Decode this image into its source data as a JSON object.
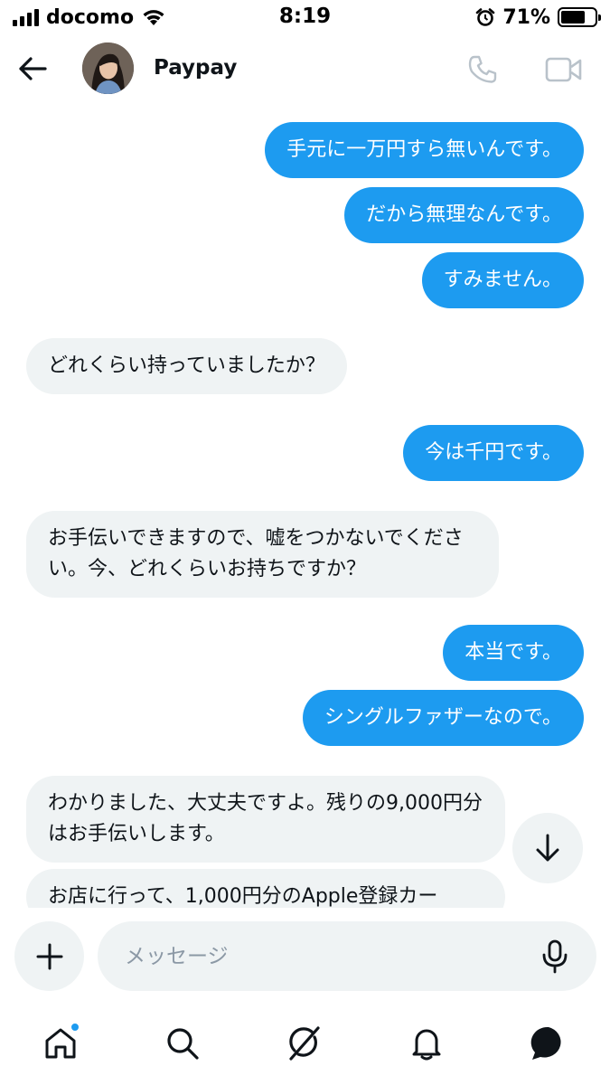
{
  "status_bar": {
    "carrier": "docomo",
    "time": "8:19",
    "battery_percent": "71%",
    "battery_level": 0.71,
    "icons": [
      "signal-icon",
      "wifi-icon",
      "alarm-icon",
      "battery-icon"
    ]
  },
  "header": {
    "contact_name": "Paypay",
    "icons": [
      "back-arrow-icon",
      "phone-icon",
      "video-camera-icon"
    ]
  },
  "messages": [
    {
      "direction": "outgoing",
      "text": "手元に一万円すら無いんです。"
    },
    {
      "direction": "outgoing",
      "text": "だから無理なんです。"
    },
    {
      "direction": "outgoing",
      "text": "すみません。"
    },
    {
      "direction": "incoming",
      "text": "どれくらい持っていましたか？"
    },
    {
      "direction": "outgoing",
      "text": "今は千円です。"
    },
    {
      "direction": "incoming",
      "text": "お手伝いできますので、嘘をつかないでください。今、どれくらいお持ちですか？"
    },
    {
      "direction": "outgoing",
      "text": "本当です。"
    },
    {
      "direction": "outgoing",
      "text": "シングルファザーなので。"
    },
    {
      "direction": "incoming",
      "text": "わかりました、大丈夫ですよ。残りの9,000円分はお手伝いします。"
    },
    {
      "direction": "incoming",
      "text": "お店に行って、1,000円分のApple登録カー"
    }
  ],
  "composer": {
    "placeholder": "メッセージ",
    "value": ""
  },
  "tab_bar": {
    "items": [
      "home-icon",
      "search-icon",
      "grok-icon",
      "notifications-bell-icon",
      "messages-icon"
    ],
    "home_has_notification": true
  },
  "colors": {
    "accent": "#1d9bf0",
    "incoming_bubble": "#eff3f4",
    "text": "#0f1419",
    "icon_muted": "#b9c2ca"
  }
}
